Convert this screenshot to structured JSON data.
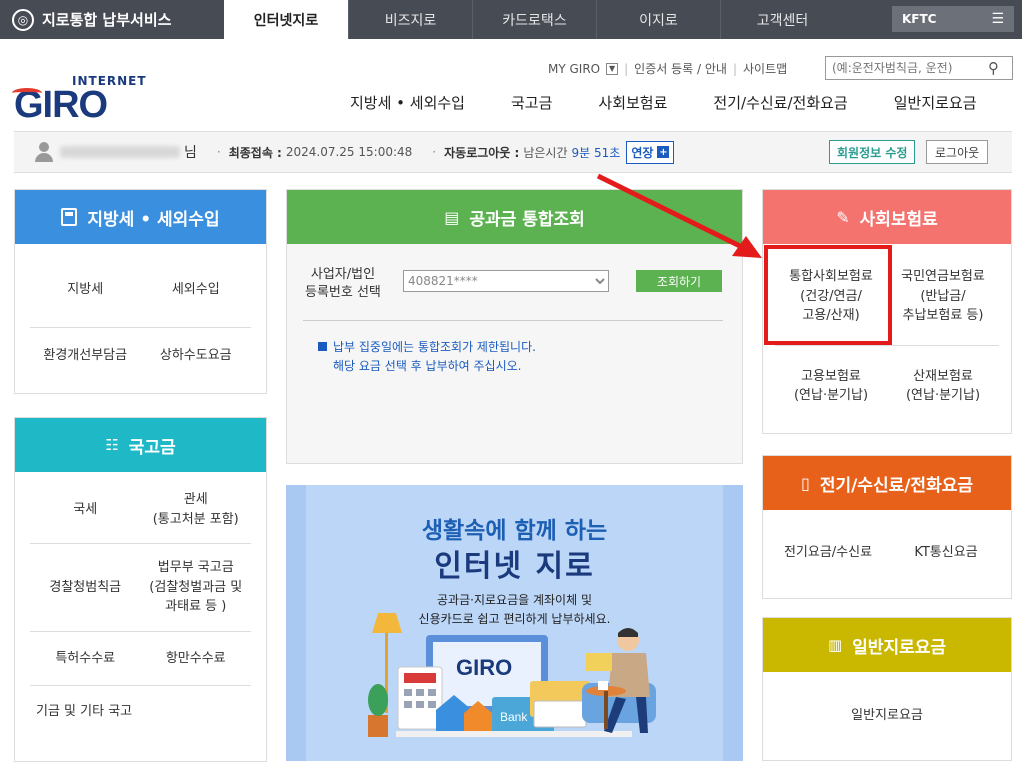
{
  "topbar": {
    "brand": "지로통합 납부서비스",
    "tabs": [
      "인터넷지로",
      "비즈지로",
      "카드로택스",
      "이지로",
      "고객센터"
    ],
    "kftc": "KFTC"
  },
  "logo": {
    "small": "INTERNET",
    "big": "GIRO"
  },
  "util": {
    "mygiro": "MY GIRO",
    "cert": "인증서 등록 / 안내",
    "sitemap": "사이트맵"
  },
  "search": {
    "placeholder": "(예:운전자범칙금, 운전)"
  },
  "mainmenu": [
    "지방세 • 세외수입",
    "국고금",
    "사회보험료",
    "전기/수신료/전화요금",
    "일반지로요금"
  ],
  "user": {
    "suffix": "님",
    "last_login_label": "최종접속 :",
    "last_login": "2024.07.25 15:00:48",
    "auto_logout_label": "자동로그아웃 :",
    "remaining_label": "남은시간",
    "remaining": "9분 51초",
    "extend": "연장",
    "edit": "회원정보 수정",
    "logout": "로그아웃"
  },
  "local_tax": {
    "title": "지방세 • 세외수입",
    "color": "#3a8fde",
    "items": [
      "지방세",
      "세외수입",
      "환경개선부담금",
      "상하수도요금"
    ]
  },
  "national": {
    "title": "국고금",
    "color": "#1fb8c6",
    "items": [
      "국세",
      "관세\n(통고처분 포함)",
      "경찰청범칙금",
      "법무부 국고금\n(검찰청벌과금 및\n과태료 등 )",
      "특허수수료",
      "항만수수료",
      "기금 및 기타 국고"
    ]
  },
  "center": {
    "title": "공과금 통합조회",
    "label": "사업자/법인\n등록번호 선택",
    "select_value": "408821****",
    "query_btn": "조회하기",
    "note1": "납부 집중일에는 통합조회가 제한됩니다.",
    "note2": "해당 요금 선택 후 납부하여 주십시오."
  },
  "banner": {
    "line1": "생활속에 함께 하는",
    "line2": "인터넷 지로",
    "line3": "공과금·지로요금을 계좌이체 및",
    "line4": "신용카드로 쉽고 편리하게 납부하세요.",
    "bank": "Bank"
  },
  "social": {
    "title": "사회보험료",
    "color": "#f4736f",
    "items": [
      "통합사회보험료\n(건강/연금/\n고용/산재)",
      "국민연금보험료\n(반납금/\n추납보험료 등)",
      "고용보험료\n(연납·분기납)",
      "산재보험료\n(연납·분기납)"
    ]
  },
  "utility": {
    "title": "전기/수신료/전화요금",
    "color": "#e8611a",
    "items": [
      "전기요금/수신료",
      "KT통신요금"
    ]
  },
  "general": {
    "title": "일반지로요금",
    "color": "#c9b700",
    "items": [
      "일반지로요금"
    ]
  }
}
